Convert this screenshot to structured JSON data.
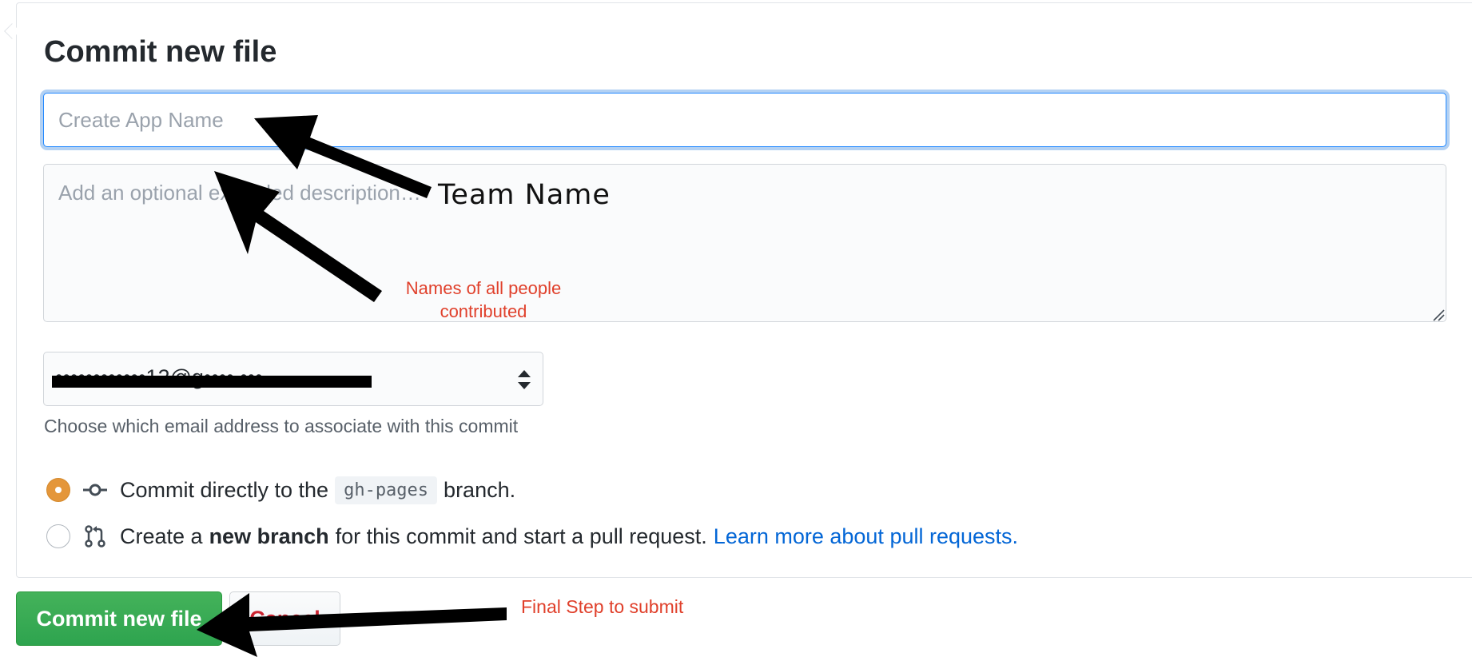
{
  "form": {
    "title": "Commit new file",
    "summary_placeholder": "Create App Name",
    "summary_value": "",
    "description_placeholder": "Add an optional extended description…",
    "description_value": ""
  },
  "email": {
    "selected_value": "••••••••••••12@g••••.•••",
    "note": "Choose which email address to associate with this commit"
  },
  "branch_options": {
    "direct": {
      "selected": true,
      "text_before": "Commit directly to the",
      "branch": "gh-pages",
      "text_after": "branch."
    },
    "new_branch": {
      "selected": false,
      "text_before": "Create a",
      "bold": "new branch",
      "text_after": "for this commit and start a pull request.",
      "link": "Learn more about pull requests."
    }
  },
  "buttons": {
    "commit_label": "Commit new file",
    "cancel_label": "Cancel"
  },
  "annotations": {
    "team_name": "Team Name",
    "names_note": "Names of all people contributed",
    "final_step": "Final Step to submit",
    "text_color": "#e0402b",
    "arrow_color": "#000000"
  },
  "colors": {
    "focus_border": "#2188ff",
    "commit_green": "#2ea44f",
    "cancel_red": "#cb2431",
    "radio_selected": "#e4963a",
    "link_blue": "#0366d6"
  }
}
